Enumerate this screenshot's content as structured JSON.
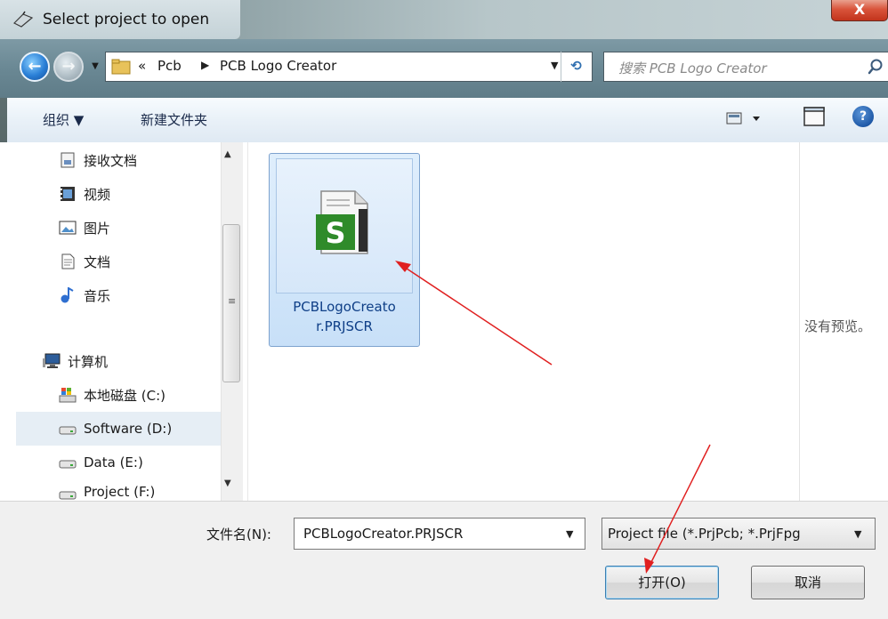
{
  "window": {
    "title": "Select project to open",
    "close_label": "X"
  },
  "nav": {
    "back_label": "←",
    "forward_label": "→",
    "history_label": "▼",
    "breadcrumb_chevron": "«",
    "breadcrumb": [
      "Pcb",
      "PCB Logo Creator"
    ],
    "breadcrumb_sep": "▶",
    "address_dropdown": "▼",
    "refresh_label": "⟲",
    "search_placeholder": "搜索 PCB Logo Creator"
  },
  "toolbar": {
    "organize_label": "组织 ▼",
    "new_folder_label": "新建文件夹",
    "help_label": "?"
  },
  "sidebar": {
    "items": [
      {
        "label": "接收文档",
        "icon": "document-inbox-icon"
      },
      {
        "label": "视频",
        "icon": "video-icon"
      },
      {
        "label": "图片",
        "icon": "picture-icon"
      },
      {
        "label": "文档",
        "icon": "document-icon"
      },
      {
        "label": "音乐",
        "icon": "music-icon"
      },
      {
        "label": "计算机",
        "icon": "computer-icon"
      },
      {
        "label": "本地磁盘 (C:)",
        "icon": "windows-drive-icon"
      },
      {
        "label": "Software (D:)",
        "icon": "drive-icon"
      },
      {
        "label": "Data (E:)",
        "icon": "drive-icon"
      },
      {
        "label": "Project (F:)",
        "icon": "drive-icon"
      }
    ],
    "selected": "Software (D:)",
    "scroll_grip": "≡",
    "scroll_up": "▲",
    "scroll_down": "▼"
  },
  "files": [
    {
      "name": "PCBLogoCreator.PRJSCR",
      "name_line1": "PCBLogoCreato",
      "name_line2": "r.PRJSCR",
      "icon": "script-project-icon",
      "selected": true
    }
  ],
  "file_icon_letter": "S",
  "preview": {
    "text": "没有预览。"
  },
  "bottom": {
    "filename_label": "文件名(N):",
    "filename_value": "PCBLogoCreator.PRJSCR",
    "filename_dropdown": "▼",
    "filetype_value": "Project file (*.PrjPcb; *.PrjFpg",
    "filetype_dropdown": "▼",
    "open_label": "打开(O)",
    "cancel_label": "取消"
  },
  "colors": {
    "accent": "#3c7fb1",
    "selection": "#c8e0f8",
    "annotation_arrow": "#e02020",
    "file_icon_green": "#2f8b2a"
  }
}
